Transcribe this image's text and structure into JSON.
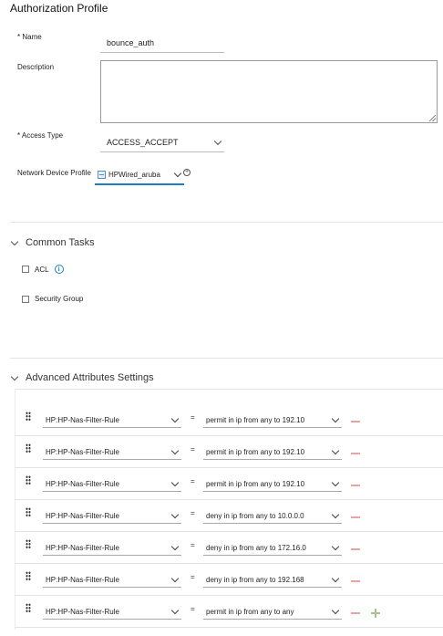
{
  "page": {
    "title": "Authorization Profile"
  },
  "form": {
    "name_label": "* Name",
    "name_value": "bounce_auth",
    "description_label": "Description",
    "description_value": "",
    "access_type_label": "* Access Type",
    "access_type_value": "ACCESS_ACCEPT",
    "ndp_label": "Network Device Profile",
    "ndp_value": "HPWired_aruba"
  },
  "common_tasks": {
    "header": "Common Tasks",
    "items": [
      {
        "label": "ACL",
        "checked": false
      },
      {
        "label": "Security Group",
        "checked": false
      }
    ]
  },
  "advanced": {
    "header": "Advanced Attributes Settings",
    "rows": [
      {
        "attribute": "HP:HP-Nas-Filter-Rule",
        "operator": "=",
        "value": "permit in ip from any to 192.10"
      },
      {
        "attribute": "HP:HP-Nas-Filter-Rule",
        "operator": "=",
        "value": "permit in ip from any to 192.10"
      },
      {
        "attribute": "HP:HP-Nas-Filter-Rule",
        "operator": "=",
        "value": "permit in ip from any to 192.10"
      },
      {
        "attribute": "HP:HP-Nas-Filter-Rule",
        "operator": "=",
        "value": "deny in ip from any to 10.0.0.0"
      },
      {
        "attribute": "HP:HP-Nas-Filter-Rule",
        "operator": "=",
        "value": "deny in ip from any to 172.16.0"
      },
      {
        "attribute": "HP:HP-Nas-Filter-Rule",
        "operator": "=",
        "value": "deny in ip from any to 192.168"
      },
      {
        "attribute": "HP:HP-Nas-Filter-Rule",
        "operator": "=",
        "value": "permit in ip from any to any"
      }
    ]
  },
  "colors": {
    "accent": "#1b7fc4",
    "remove": "#e8a3a3",
    "add": "#a8c48a"
  }
}
